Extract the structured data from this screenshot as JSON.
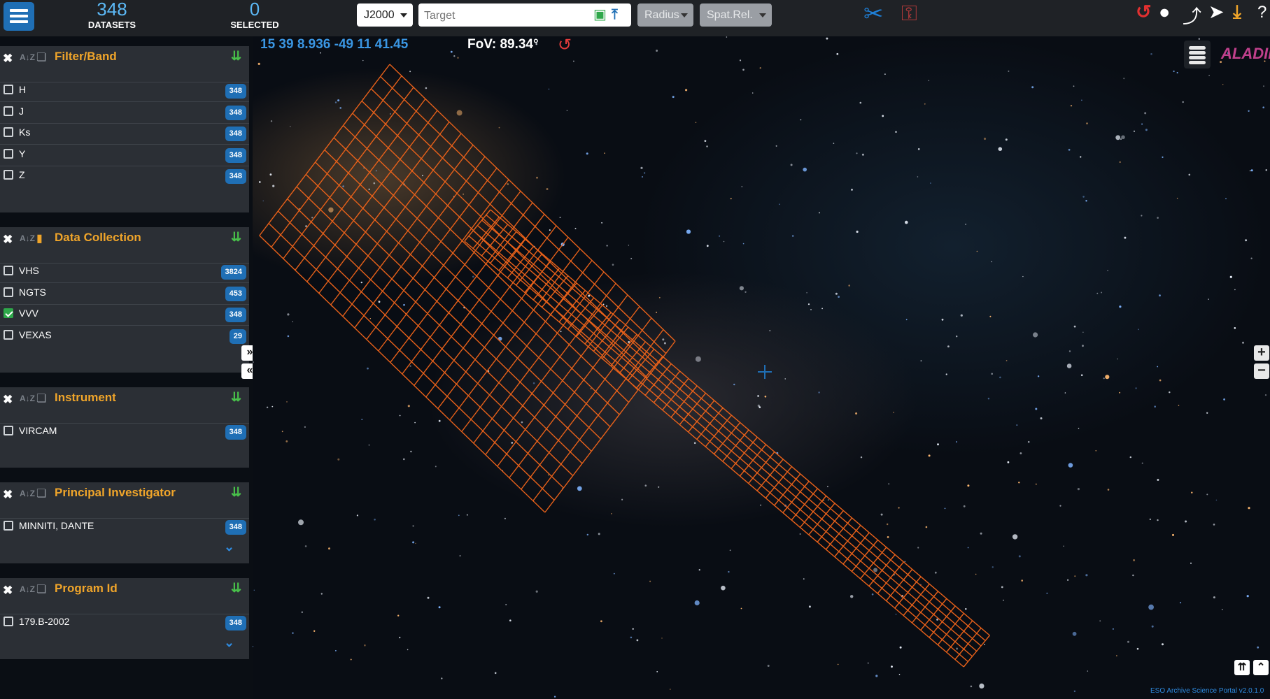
{
  "header": {
    "datasets_count": "348",
    "datasets_label": "DATASETS",
    "selected_count": "0",
    "selected_label": "SELECTED",
    "frame_value": "J2000",
    "target_placeholder": "Target",
    "radius_label": "Radius",
    "spatrel_label": "Spat.Rel."
  },
  "sidebar": {
    "panels": [
      {
        "title": "Filter/Band",
        "bookmarked": false,
        "rows": [
          {
            "label": "H",
            "count": "348",
            "checked": false
          },
          {
            "label": "J",
            "count": "348",
            "checked": false
          },
          {
            "label": "Ks",
            "count": "348",
            "checked": false
          },
          {
            "label": "Y",
            "count": "348",
            "checked": false
          },
          {
            "label": "Z",
            "count": "348",
            "checked": false
          }
        ]
      },
      {
        "title": "Data Collection",
        "bookmarked": true,
        "rows": [
          {
            "label": "VHS",
            "count": "3824",
            "checked": false
          },
          {
            "label": "NGTS",
            "count": "453",
            "checked": false
          },
          {
            "label": "VVV",
            "count": "348",
            "checked": true
          },
          {
            "label": "VEXAS",
            "count": "29",
            "checked": false
          }
        ]
      },
      {
        "title": "Instrument",
        "bookmarked": false,
        "rows": [
          {
            "label": "VIRCAM",
            "count": "348",
            "checked": false
          }
        ]
      },
      {
        "title": "Principal Investigator",
        "bookmarked": false,
        "rows": [
          {
            "label": "MINNITI, DANTE",
            "count": "348",
            "checked": false
          }
        ]
      },
      {
        "title": "Program Id",
        "bookmarked": false,
        "rows": [
          {
            "label": "179.B-2002",
            "count": "348",
            "checked": false
          }
        ]
      }
    ]
  },
  "sky": {
    "coordinates": "15 39 8.936 -49 11 41.45",
    "fov": "FoV: 89.34°",
    "aladin_logo": "ALADIN",
    "footprint_color": "#e8611a"
  },
  "footer": {
    "version": "ESO Archive Science Portal v2.0.1.0"
  },
  "colors": {
    "accent": "#1f6fb5",
    "panel_title": "#f0a52a",
    "sort_icon": "#48c04a",
    "checked": "#2ea84a"
  }
}
